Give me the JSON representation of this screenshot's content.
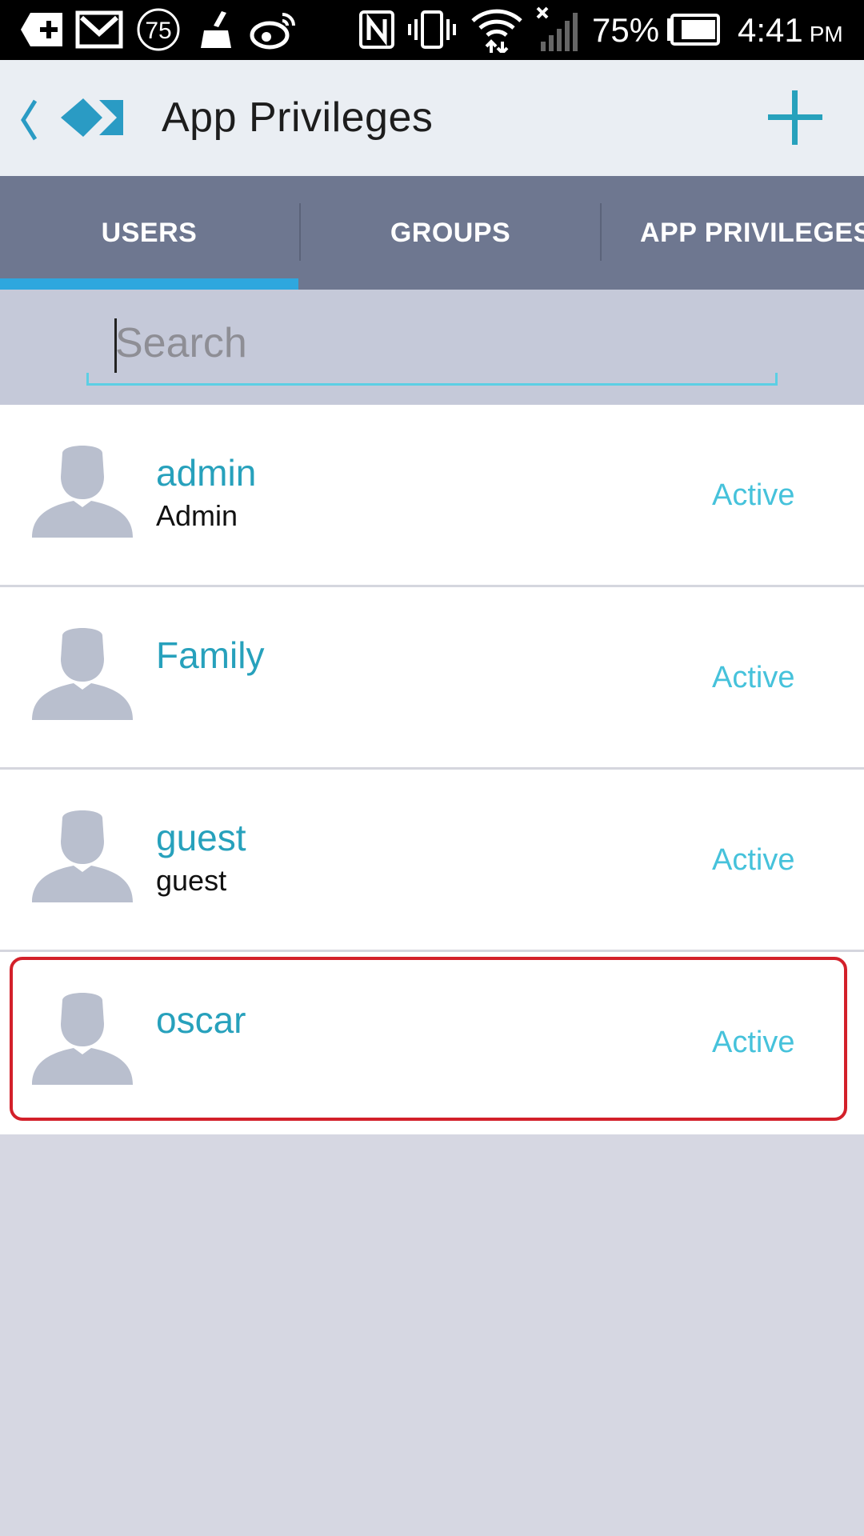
{
  "status_bar": {
    "icons": [
      "add-box-icon",
      "gmail-icon",
      "notification-count-icon",
      "cleaner-icon",
      "weibo-icon",
      "nfc-icon",
      "vibrate-icon",
      "wifi-icon",
      "signal-icon",
      "battery-icon"
    ],
    "notification_count": "75",
    "battery_percent": "75%",
    "time": "4:41",
    "time_suffix": "PM"
  },
  "header": {
    "title": "App Privileges",
    "back_icon": "chevron-left-icon",
    "logo_icon": "app-logo-icon",
    "add_icon": "plus-icon"
  },
  "tabs": [
    {
      "label": "USERS",
      "selected": true
    },
    {
      "label": "GROUPS",
      "selected": false
    },
    {
      "label": "APP PRIVILEGES",
      "selected": false
    }
  ],
  "search": {
    "placeholder": "Search",
    "value": ""
  },
  "users": [
    {
      "name": "admin",
      "subtitle": "Admin",
      "status": "Active"
    },
    {
      "name": "Family",
      "subtitle": "",
      "status": "Active"
    },
    {
      "name": "guest",
      "subtitle": "guest",
      "status": "Active"
    },
    {
      "name": "oscar",
      "subtitle": "",
      "status": "Active",
      "highlighted": true
    }
  ],
  "colors": {
    "accent": "#27a1bc",
    "status_active": "#46c2db",
    "tab_bar": "#6e7790",
    "tab_indicator": "#2ea7de",
    "highlight": "#d3202a"
  }
}
